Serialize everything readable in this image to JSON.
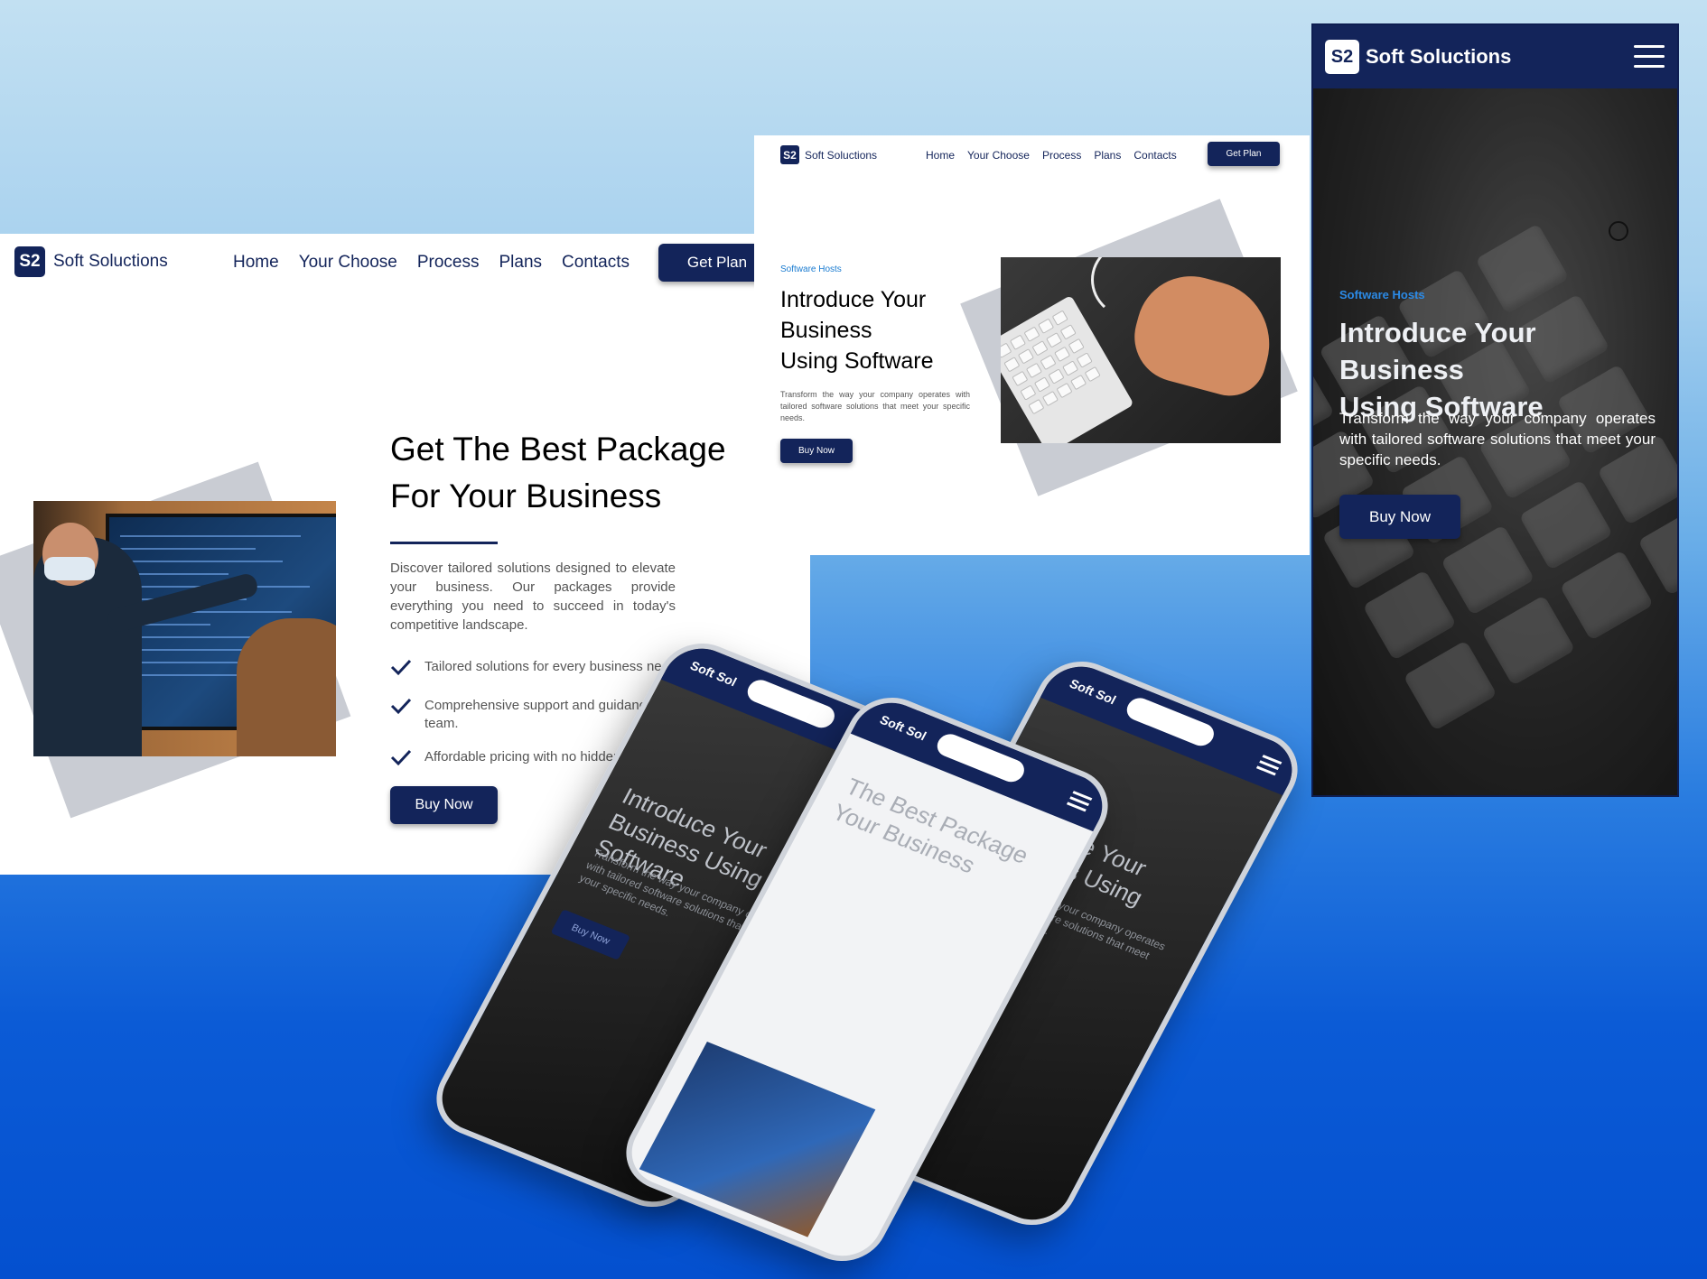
{
  "desktop": {
    "brand": {
      "logo": "S2",
      "name": "Soft Soluctions"
    },
    "nav": [
      "Home",
      "Your Choose",
      "Process",
      "Plans",
      "Contacts"
    ],
    "cta": "Get Plan",
    "headline_1": "Get The Best Package",
    "headline_2": "For Your Business",
    "description": "Discover tailored solutions designed to elevate your business. Our packages provide everything you need to succeed in today's competitive landscape.",
    "features": [
      "Tailored solutions for every business need.",
      "Comprehensive support and guidance fr",
      "team.",
      "Affordable pricing with no hidden fe"
    ],
    "button": "Buy Now"
  },
  "tablet": {
    "brand": {
      "logo": "S2",
      "name": "Soft Soluctions"
    },
    "nav": [
      "Home",
      "Your Choose",
      "Process",
      "Plans",
      "Contacts"
    ],
    "cta": "Get Plan",
    "kicker": "Software Hosts",
    "headline_1": "Introduce Your",
    "headline_2": "Business",
    "headline_3": "Using Software",
    "description": "Transform the way your company operates with tailored software solutions that meet your specific needs.",
    "button": "Buy Now"
  },
  "mobile": {
    "brand": {
      "logo": "S2",
      "name": "Soft Soluctions"
    },
    "kicker": "Software Hosts",
    "headline_1": "Introduce Your Business",
    "headline_2": "Using Software",
    "description": "Transform the way your company operates with tailored software solutions that meet your specific needs.",
    "button": "Buy Now"
  },
  "phones": {
    "title": "Soft Sol",
    "headline": "Introduce Your Business Using Software",
    "text": "Transform the way your company operates with tailored software solutions that meet your specific needs.",
    "button": "Buy Now",
    "white_headline": "The Best Package Your Business"
  },
  "icons": [
    "check-icon",
    "hamburger-menu-icon"
  ],
  "colors": {
    "brand_navy": "#13245a",
    "kicker_blue": "#1a7bd0",
    "background_blue": "#0450cf"
  }
}
